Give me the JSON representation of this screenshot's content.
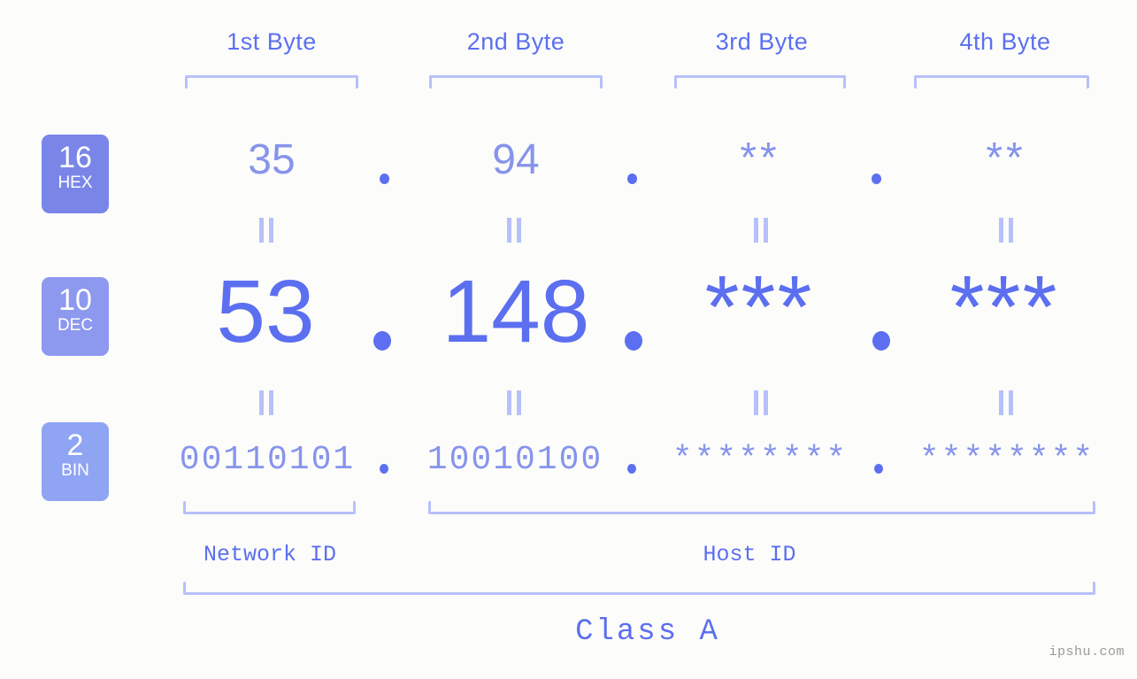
{
  "theme": {
    "background": "#fcfdfa",
    "accent_strong": "#5c6ff0",
    "accent_mid": "#8794ec",
    "accent_light": "#b7c0fb",
    "badge_hex_bg": "#7986e8",
    "badge_dec_bg": "#8d98ef",
    "badge_bin_bg": "#8fa4f3",
    "watermark_color": "#9a9a9a"
  },
  "header": {
    "byte_labels": [
      {
        "text": "1st Byte"
      },
      {
        "text": "2nd Byte"
      },
      {
        "text": "3rd Byte"
      },
      {
        "text": "4th Byte"
      }
    ]
  },
  "badges": [
    {
      "base": "16",
      "name": "HEX"
    },
    {
      "base": "10",
      "name": "DEC"
    },
    {
      "base": "2",
      "name": "BIN"
    }
  ],
  "rows": {
    "hex": {
      "label": "HEX",
      "base": "16",
      "octets": [
        "35",
        "94",
        "**",
        "**"
      ],
      "separators": [
        ".",
        ".",
        "."
      ]
    },
    "dec": {
      "label": "DEC",
      "base": "10",
      "octets": [
        "53",
        "148",
        "***",
        "***"
      ],
      "separators": [
        ".",
        ".",
        "."
      ]
    },
    "bin": {
      "label": "BIN",
      "base": "2",
      "octets": [
        "00110101",
        "10010100",
        "********",
        "********"
      ],
      "separators": [
        ".",
        ".",
        "."
      ]
    }
  },
  "connectors": {
    "glyph": "||",
    "meaning": "equals"
  },
  "segments": {
    "network_id": "Network ID",
    "host_id": "Host ID",
    "class": "Class A"
  },
  "watermark": {
    "text": "ipshu.com"
  }
}
